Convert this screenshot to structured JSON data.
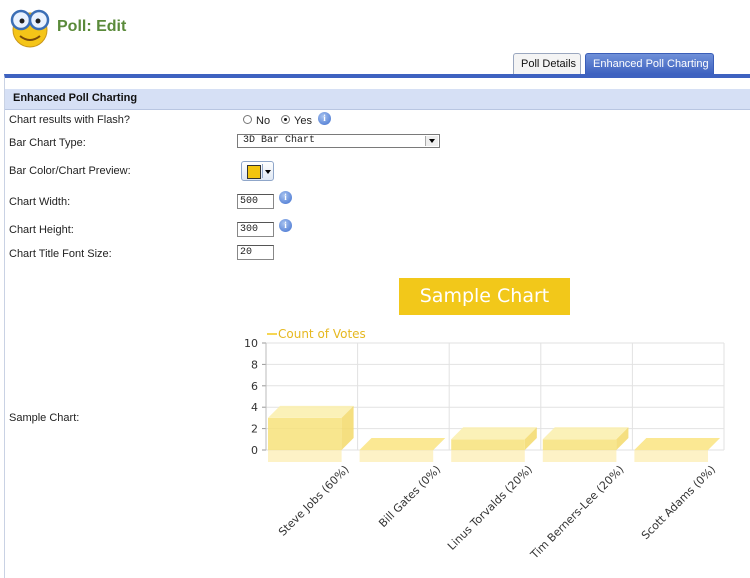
{
  "header": {
    "title": "Poll: Edit",
    "logo_icon": "smiley-glasses-icon"
  },
  "tabs": [
    {
      "label": "Poll Details",
      "active": false
    },
    {
      "label": "Enhanced Poll Charting",
      "active": true
    }
  ],
  "section": {
    "title": "Enhanced Poll Charting"
  },
  "form": {
    "flash_label": "Chart results with Flash?",
    "flash_no": "No",
    "flash_yes": "Yes",
    "flash_value": "Yes",
    "bar_type_label": "Bar Chart Type:",
    "bar_type_value": "3D Bar Chart",
    "bar_color_label": "Bar Color/Chart Preview:",
    "bar_color": "#f2c40f",
    "width_label": "Chart Width:",
    "width_value": "500",
    "height_label": "Chart Height:",
    "height_value": "300",
    "font_label": "Chart Title Font Size:",
    "font_value": "20",
    "sample_label": "Sample Chart:"
  },
  "chart_data": {
    "type": "bar",
    "title": "Sample Chart",
    "legend": "Count of Votes",
    "legend_position": "top-left",
    "categories": [
      "Steve Jobs (60%)",
      "Bill Gates (0%)",
      "Linus Torvalds (20%)",
      "Tim Berners-Lee (20%)",
      "Scott Adams (0%)"
    ],
    "values": [
      3,
      0,
      1,
      1,
      0
    ],
    "ylim": [
      0,
      10
    ],
    "yticks": [
      "0",
      "2",
      "4",
      "6",
      "8",
      "10"
    ],
    "grid": true,
    "bar_color": "#f7e27a",
    "title_bg": "#f2c81a"
  }
}
